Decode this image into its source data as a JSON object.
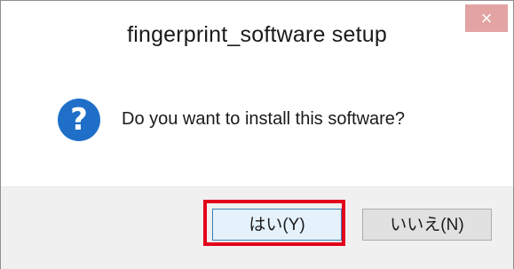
{
  "window": {
    "title": "fingerprint_software setup",
    "close_label": "×"
  },
  "dialog": {
    "icon": "question-icon",
    "icon_glyph": "?",
    "message": "Do you want to install this software?"
  },
  "buttons": {
    "yes_label": "はい(Y)",
    "no_label": "いいえ(N)"
  },
  "colors": {
    "icon_blue": "#1f6fc9",
    "close_bg": "#e3a3a3",
    "highlight_red": "#e3001b",
    "footer_bg": "#f0f0f0"
  }
}
